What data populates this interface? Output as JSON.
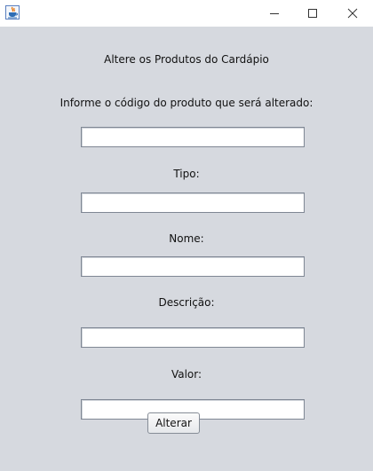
{
  "titlebar": {
    "app_icon": "java-coffee-cup-icon",
    "minimize_icon": "minimize-icon",
    "maximize_icon": "maximize-icon",
    "close_icon": "close-icon"
  },
  "form": {
    "title": "Altere os Produtos do Cardápio",
    "code_label": "Informe o código do produto que será alterado:",
    "code_value": "",
    "type_label": "Tipo:",
    "type_value": "",
    "name_label": "Nome:",
    "name_value": "",
    "description_label": "Descrição:",
    "description_value": "",
    "price_label": "Valor:",
    "price_value": "",
    "submit_label": "Alterar"
  },
  "colors": {
    "background": "#d6d9df",
    "titlebar": "#ffffff",
    "field_border": "#7f8794",
    "java_blue": "#2f6db4",
    "java_orange": "#e76f00"
  }
}
